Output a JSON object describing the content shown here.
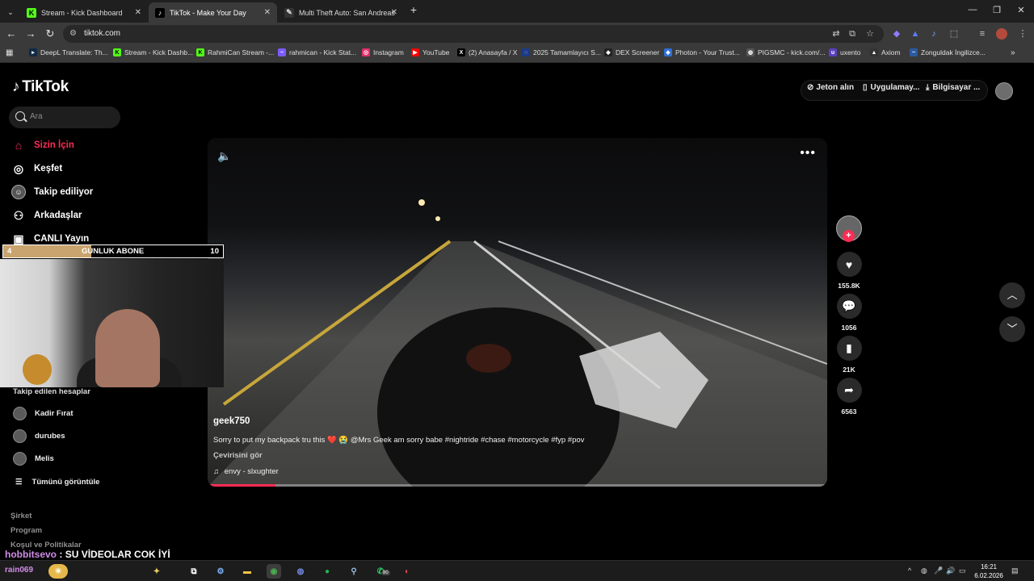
{
  "browser": {
    "tabs": [
      {
        "label": "Stream - Kick Dashboard",
        "color": "#53fc18",
        "glyph": "K"
      },
      {
        "label": "TikTok - Make Your Day",
        "color": "#000000",
        "glyph": "♪",
        "active": true
      },
      {
        "label": "Multi Theft Auto: San Andreas",
        "color": "#333333",
        "glyph": "✎"
      }
    ],
    "new_tab": "+",
    "address": "tiktok.com",
    "bookmarks": [
      {
        "label": "DeepL Translate: Th...",
        "glyph": "▸",
        "color": "#0f2b46"
      },
      {
        "label": "Stream - Kick Dashb...",
        "glyph": "K",
        "color": "#53fc18"
      },
      {
        "label": "RahmiCan Stream -...",
        "glyph": "K",
        "color": "#53fc18"
      },
      {
        "label": "rahmican - Kick Stat...",
        "glyph": "~",
        "color": "#7b5cff"
      },
      {
        "label": "Instagram",
        "glyph": "◎",
        "color": "#e1306c"
      },
      {
        "label": "YouTube",
        "glyph": "▶",
        "color": "#ff0000"
      },
      {
        "label": "(2) Anasayfa / X",
        "glyph": "X",
        "color": "#000000"
      },
      {
        "label": "2025 Tamamlayıcı S...",
        "glyph": "◌",
        "color": "#1a3a8a"
      },
      {
        "label": "DEX Screener",
        "glyph": "◆",
        "color": "#222222"
      },
      {
        "label": "Photon - Your Trust...",
        "glyph": "◈",
        "color": "#2d6fd6"
      },
      {
        "label": "PIGSMC - kick.com/...",
        "glyph": "◍",
        "color": "#555555"
      },
      {
        "label": "uxento",
        "glyph": "u",
        "color": "#5a3fc0"
      },
      {
        "label": "Axiom",
        "glyph": "▲",
        "color": "#333333"
      },
      {
        "label": "Zonguldak İngilizce...",
        "glyph": "~",
        "color": "#2c5aa0"
      }
    ]
  },
  "tiktok": {
    "logo": "TikTok",
    "search_placeholder": "Ara",
    "nav": [
      {
        "label": "Sizin İçin",
        "icon": "home-icon",
        "active": true
      },
      {
        "label": "Keşfet",
        "icon": "compass-icon"
      },
      {
        "label": "Takip ediliyor",
        "icon": "following-icon"
      },
      {
        "label": "Arkadaşlar",
        "icon": "friends-icon"
      },
      {
        "label": "CANLI Yayın",
        "icon": "live-icon"
      }
    ],
    "header": {
      "coins": "Jeton alın",
      "app": "Uygulamay...",
      "desktop": "Bilgisayar ..."
    },
    "following_title": "Takip edilen hesaplar",
    "following": [
      "Kadir Fırat",
      "durubes",
      "Melis"
    ],
    "see_all": "Tümünü görüntüle",
    "footer": [
      "Şirket",
      "Program",
      "Koşul ve Politikalar"
    ],
    "video": {
      "author": "geek750",
      "caption": "Sorry to put my backpack tru this ❤️ 😭 @Mrs Geek am sorry babe #nightride #chase #motorcycle #fyp #pov",
      "translate": "Çevirisini gör",
      "music": "envy - slxughter",
      "progress": 0.11
    },
    "actions": {
      "likes": "155.8K",
      "comments": "1056",
      "saves": "21K",
      "shares": "6563"
    }
  },
  "overlay": {
    "abone_left": "4",
    "abone_label": "GUNLUK ABONE",
    "abone_right": "10",
    "abone_progress": 0.4,
    "chat_user": "hobbitsevo",
    "chat_sep": " : ",
    "chat_text": "SU VİDEOLAR COK İYİ",
    "chat_user2": "rain069"
  },
  "taskbar": {
    "time": "16:21",
    "date": "6.02.2026",
    "steam_badge": "99",
    "whatsapp_badge": "80"
  },
  "colors": {
    "accent": "#fe2c55",
    "kick_green": "#53fc18"
  }
}
